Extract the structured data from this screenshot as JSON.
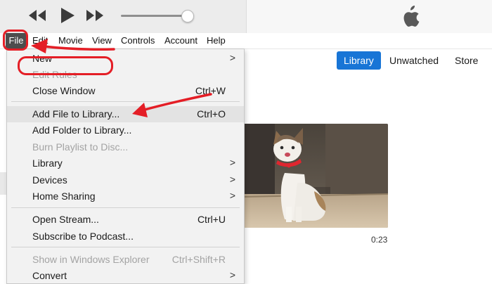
{
  "player": {
    "controls": [
      {
        "name": "rewind-icon",
        "glyph": "rewind"
      },
      {
        "name": "play-icon",
        "glyph": "play"
      },
      {
        "name": "fast-forward-icon",
        "glyph": "fast-forward"
      }
    ],
    "volume_level": 0.9,
    "logo": "apple-logo-icon"
  },
  "menubar": {
    "items": [
      "File",
      "Edit",
      "Movie",
      "View",
      "Controls",
      "Account",
      "Help"
    ],
    "active": "File"
  },
  "file_menu": {
    "items": [
      {
        "label": "New",
        "shortcut": "",
        "submenu": true,
        "disabled": false
      },
      {
        "label": "Edit Rules",
        "shortcut": "",
        "submenu": false,
        "disabled": true
      },
      {
        "label": "Close Window",
        "shortcut": "Ctrl+W",
        "submenu": false,
        "disabled": false
      },
      {
        "label": "Add File to Library...",
        "shortcut": "Ctrl+O",
        "submenu": false,
        "disabled": false,
        "highlighted": true
      },
      {
        "label": "Add Folder to Library...",
        "shortcut": "",
        "submenu": false,
        "disabled": false
      },
      {
        "label": "Burn Playlist to Disc...",
        "shortcut": "",
        "submenu": false,
        "disabled": true
      },
      {
        "label": "Library",
        "shortcut": "",
        "submenu": true,
        "disabled": false
      },
      {
        "label": "Devices",
        "shortcut": "",
        "submenu": true,
        "disabled": false
      },
      {
        "label": "Home Sharing",
        "shortcut": "",
        "submenu": true,
        "disabled": false
      },
      {
        "label": "Open Stream...",
        "shortcut": "Ctrl+U",
        "submenu": false,
        "disabled": false
      },
      {
        "label": "Subscribe to Podcast...",
        "shortcut": "",
        "submenu": false,
        "disabled": false
      },
      {
        "label": "Show in Windows Explorer",
        "shortcut": "Ctrl+Shift+R",
        "submenu": false,
        "disabled": true
      },
      {
        "label": "Convert",
        "shortcut": "",
        "submenu": true,
        "disabled": false
      }
    ],
    "submenu_glyph": ">"
  },
  "view_tabs": [
    {
      "label": "Library",
      "active": true
    },
    {
      "label": "Unwatched",
      "active": false
    },
    {
      "label": "Store",
      "active": false
    }
  ],
  "video": {
    "thumbnail": "cat-video-thumbnail",
    "duration": "0:23"
  },
  "annotations": {
    "highlight_color": "#e41e26",
    "marks": [
      "file-menu-circle",
      "add-file-circle",
      "arrow-to-file",
      "arrow-to-add-file"
    ]
  },
  "colors": {
    "accent": "#1875d6",
    "menu_bg": "#f2f2f2",
    "disabled_text": "#a3a3a3"
  }
}
